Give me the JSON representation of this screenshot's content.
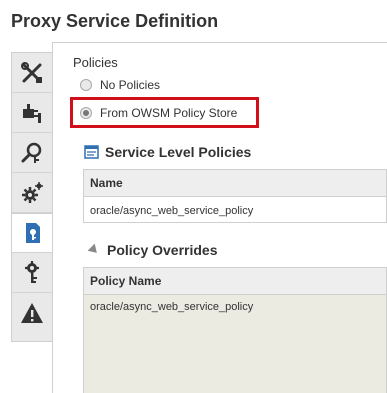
{
  "page": {
    "title": "Proxy Service Definition"
  },
  "vtabs": [
    {
      "icon": "tools-icon"
    },
    {
      "icon": "plug-icon"
    },
    {
      "icon": "search-key-icon"
    },
    {
      "icon": "gears-icon"
    },
    {
      "icon": "policy-document-icon"
    },
    {
      "icon": "gear-key-icon"
    },
    {
      "icon": "warning-icon"
    }
  ],
  "policies": {
    "label": "Policies",
    "options": [
      {
        "label": "No Policies",
        "selected": false
      },
      {
        "label": "From OWSM Policy Store",
        "selected": true
      }
    ],
    "highlight_color": "#d10f1b"
  },
  "service_level_policies": {
    "title": "Service Level Policies",
    "column": "Name",
    "rows": [
      "oracle/async_web_service_policy"
    ]
  },
  "policy_overrides": {
    "title": "Policy Overrides",
    "column": "Policy Name",
    "rows": [
      "oracle/async_web_service_policy"
    ]
  }
}
